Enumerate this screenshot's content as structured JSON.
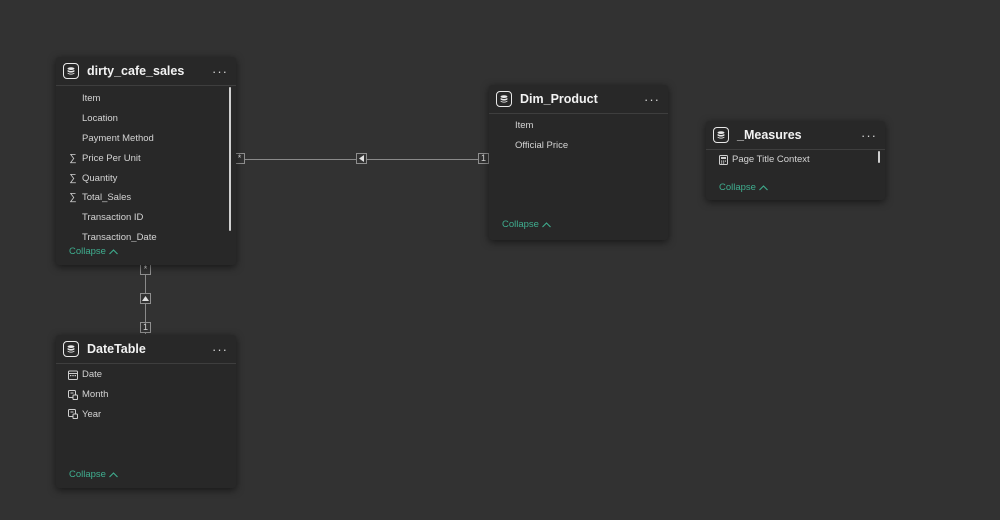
{
  "tables": {
    "cafe": {
      "title": "dirty_cafe_sales",
      "fields": [
        "Item",
        "Location",
        "Payment Method",
        "Price Per Unit",
        "Quantity",
        "Total_Sales",
        "Transaction ID",
        "Transaction_Date"
      ],
      "collapse": "Collapse"
    },
    "product": {
      "title": "Dim_Product",
      "fields": [
        "Item",
        "Official Price"
      ],
      "collapse": "Collapse"
    },
    "measures": {
      "title": "_Measures",
      "fields": [
        "Page Title Context"
      ],
      "collapse": "Collapse"
    },
    "date": {
      "title": "DateTable",
      "fields": [
        "Date",
        "Month",
        "Year"
      ],
      "collapse": "Collapse"
    }
  },
  "more_label": "···",
  "relationships": {
    "cafe_product": {
      "many": "*",
      "one": "1"
    },
    "cafe_date": {
      "many": "*",
      "one": "1"
    }
  },
  "icons": {
    "table": "table-icon",
    "sum": "sigma-icon",
    "calendar": "calendar-icon",
    "hierarchy": "hierarchy-icon",
    "measure": "calculator-icon"
  },
  "colors": {
    "canvas": "#323232",
    "card": "#282828",
    "collapse_link": "#3fae8f"
  }
}
